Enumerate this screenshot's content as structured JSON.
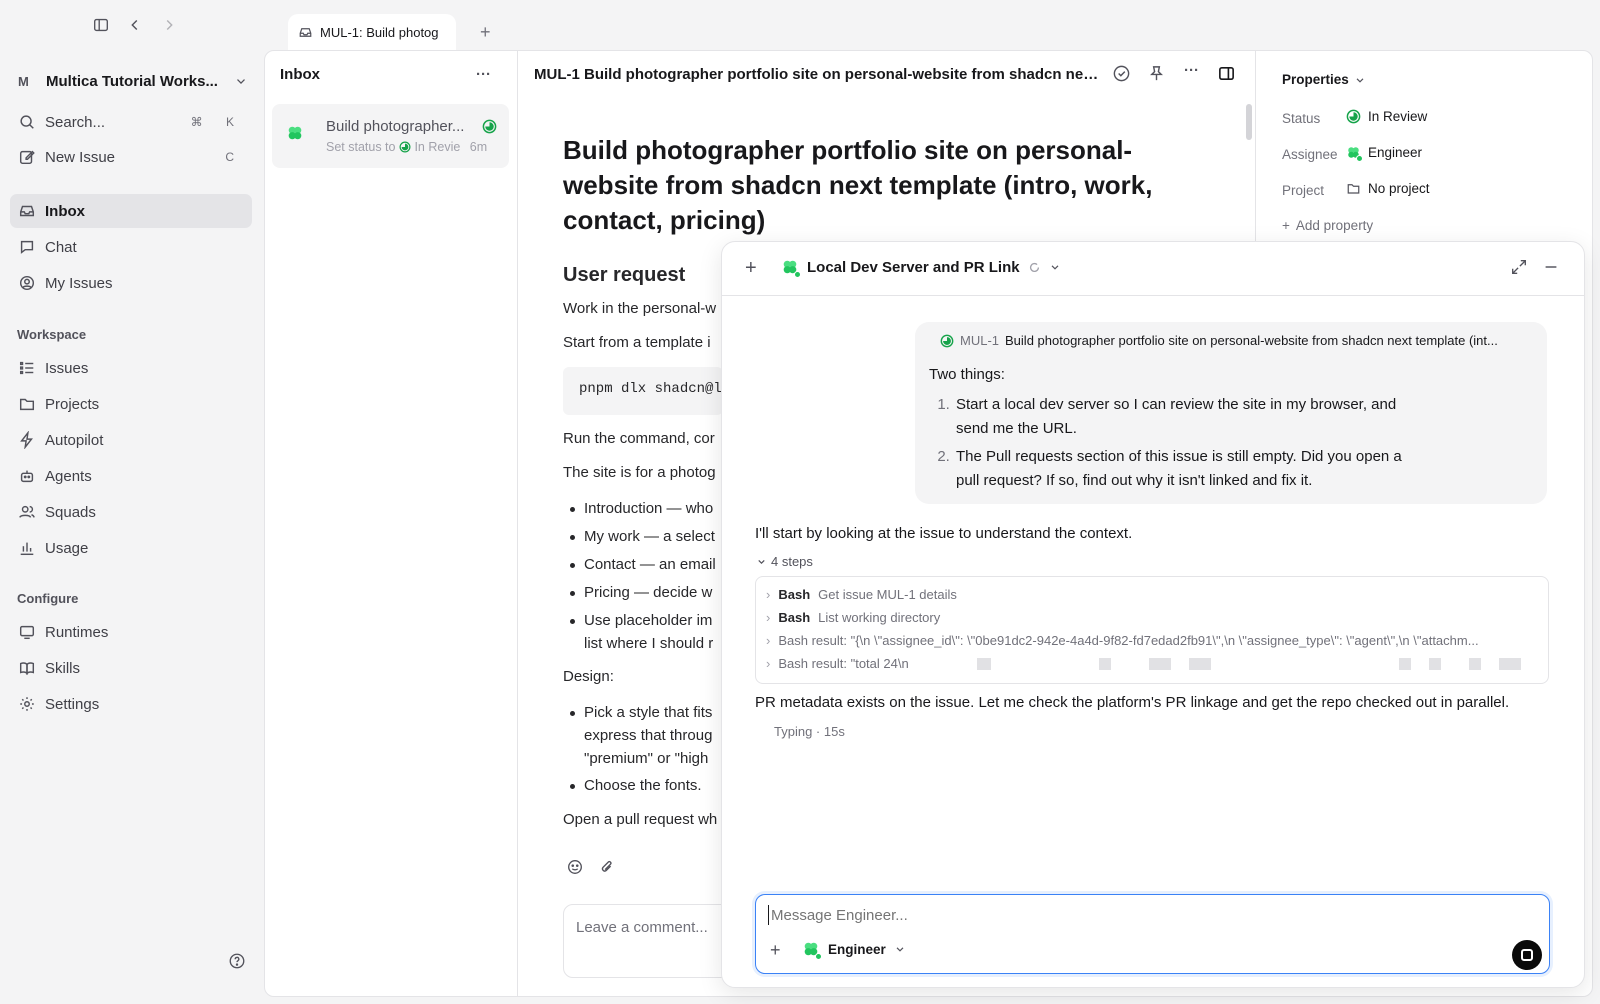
{
  "tab": {
    "title": "MUL-1: Build photog"
  },
  "sidebar": {
    "workspace_letter": "M",
    "workspace_name": "Multica Tutorial Works...",
    "search": {
      "label": "Search...",
      "shortcut": "⌘ K"
    },
    "new_issue": {
      "label": "New Issue",
      "shortcut": "C"
    },
    "top_items": [
      {
        "label": "Inbox"
      },
      {
        "label": "Chat"
      },
      {
        "label": "My Issues"
      }
    ],
    "workspace_heading": "Workspace",
    "workspace_items": [
      {
        "label": "Issues"
      },
      {
        "label": "Projects"
      },
      {
        "label": "Autopilot"
      },
      {
        "label": "Agents"
      },
      {
        "label": "Squads"
      },
      {
        "label": "Usage"
      }
    ],
    "configure_heading": "Configure",
    "configure_items": [
      {
        "label": "Runtimes"
      },
      {
        "label": "Skills"
      },
      {
        "label": "Settings"
      }
    ]
  },
  "inbox": {
    "title": "Inbox",
    "item": {
      "title": "Build photographer...",
      "subtitle_prefix": "Set status to",
      "subtitle_status": "In Revie",
      "time": "6m"
    }
  },
  "issue": {
    "header": "MUL-1 Build photographer portfolio site on personal-website from shadcn nex...",
    "title": "Build photographer portfolio site on personal-website from shadcn next template (intro, work, contact, pricing)",
    "section": "User request",
    "p1": "Work in the personal-w",
    "p2": "Start from a template i",
    "code": "pnpm dlx shadcn@l",
    "p3": "Run the command, cor",
    "p4": "The site is for a photog",
    "list1": [
      "Introduction — who",
      "My work — a select",
      "Contact — an email",
      "Pricing — decide w",
      "Use placeholder im"
    ],
    "list1_extra": "list where I should r",
    "design_label": "Design:",
    "list2": [
      "Pick a style that fits"
    ],
    "list2_extra": [
      "express that throug",
      "\"premium\" or \"high"
    ],
    "list3": [
      "Choose the fonts."
    ],
    "p5": "Open a pull request wh",
    "comment_placeholder": "Leave a comment..."
  },
  "properties": {
    "heading": "Properties",
    "status_label": "Status",
    "status_value": "In Review",
    "assignee_label": "Assignee",
    "assignee_value": "Engineer",
    "project_label": "Project",
    "project_value": "No project",
    "add_property": "Add property"
  },
  "chat": {
    "title": "Local Dev Server and PR Link",
    "ref_id": "MUL-1",
    "ref_title": "Build photographer portfolio site on personal-website from shadcn next template (int...",
    "intro": "Two things:",
    "items": [
      "Start a local dev server so I can review the site in my browser, and send me the URL.",
      "The Pull requests section of this issue is still empty. Did you open a pull request? If so, find out why it isn't linked and fix it."
    ],
    "agent_msg1": "I'll start by looking at the issue to understand the context.",
    "steps_label": "4 steps",
    "steps": [
      {
        "tool": "Bash",
        "text": "Get issue MUL-1 details"
      },
      {
        "tool": "Bash",
        "text": "List working directory"
      },
      {
        "tool": "",
        "text": "Bash result: \"{\\n \\\"assignee_id\\\": \\\"0be91dc2-942e-4a4d-9f82-fd7edad2fb91\\\",\\n \\\"assignee_type\\\": \\\"agent\\\",\\n \\\"attachm..."
      },
      {
        "tool": "",
        "text": "Bash result: \"total 24\\n"
      }
    ],
    "agent_msg2": "PR metadata exists on the issue. Let me check the platform's PR linkage and get the repo checked out in parallel.",
    "typing": "Typing · 15s",
    "composer_placeholder": "Message Engineer...",
    "composer_agent": "Engineer"
  },
  "colors": {
    "accent": "#3b82f6",
    "status_green": "#16a34a",
    "clover": "#4ade80"
  }
}
